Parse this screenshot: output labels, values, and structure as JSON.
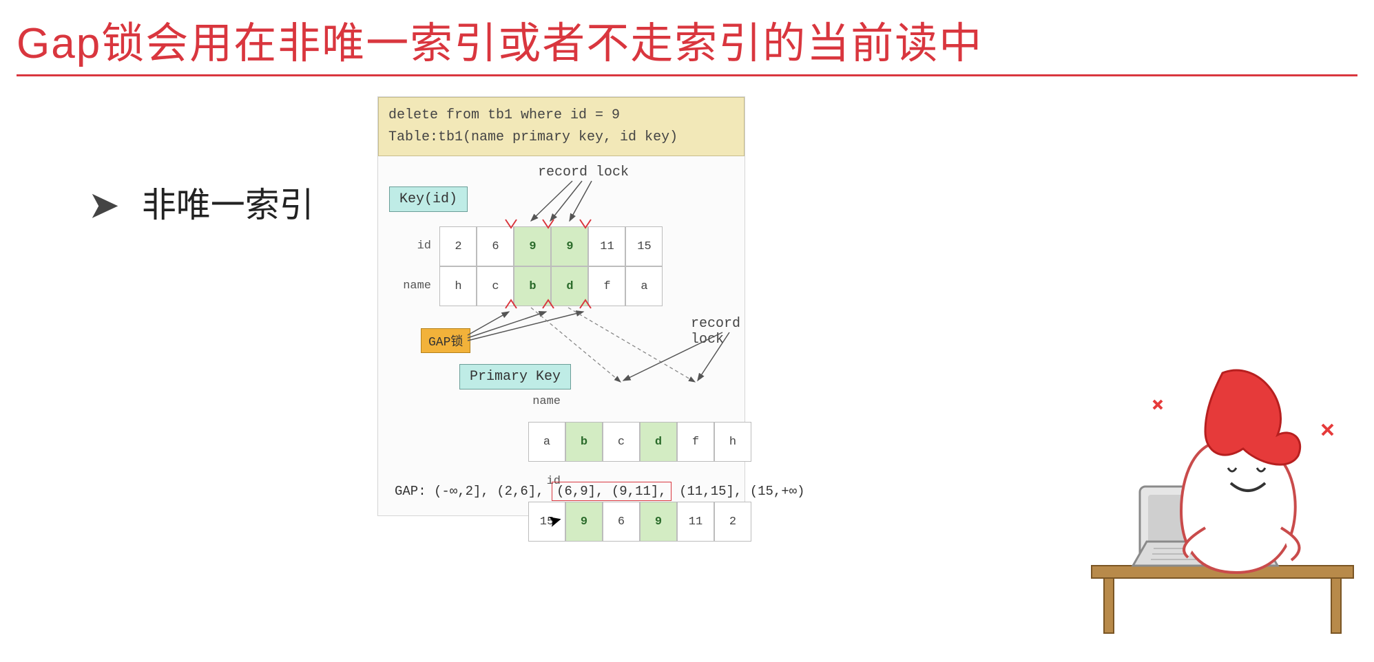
{
  "title": "Gap锁会用在非唯一索引或者不走索引的当前读中",
  "bullet": {
    "arrow": "➤",
    "text": "非唯一索引"
  },
  "sql": {
    "line1": "delete from tb1 where id = 9",
    "line2": " Table:tb1(name primary key, id key)"
  },
  "labels": {
    "record_lock": "record lock",
    "key_id": "Key(id)",
    "gap_lock": "GAP锁",
    "primary_key": "Primary Key",
    "gap_prefix": "GAP:"
  },
  "index_table": {
    "row_labels": [
      "id",
      "name"
    ],
    "rows": [
      [
        {
          "v": "2",
          "hl": false
        },
        {
          "v": "6",
          "hl": false
        },
        {
          "v": "9",
          "hl": true
        },
        {
          "v": "9",
          "hl": true
        },
        {
          "v": "11",
          "hl": false
        },
        {
          "v": "15",
          "hl": false
        }
      ],
      [
        {
          "v": "h",
          "hl": false
        },
        {
          "v": "c",
          "hl": false
        },
        {
          "v": "b",
          "hl": true
        },
        {
          "v": "d",
          "hl": true
        },
        {
          "v": "f",
          "hl": false
        },
        {
          "v": "a",
          "hl": false
        }
      ]
    ]
  },
  "pk_table": {
    "row_labels": [
      "name",
      "id"
    ],
    "rows": [
      [
        {
          "v": "a",
          "hl": false
        },
        {
          "v": "b",
          "hl": true
        },
        {
          "v": "c",
          "hl": false
        },
        {
          "v": "d",
          "hl": true
        },
        {
          "v": "f",
          "hl": false
        },
        {
          "v": "h",
          "hl": false
        }
      ],
      [
        {
          "v": "15",
          "hl": false
        },
        {
          "v": "9",
          "hl": true
        },
        {
          "v": "6",
          "hl": false
        },
        {
          "v": "9",
          "hl": true
        },
        {
          "v": "11",
          "hl": false
        },
        {
          "v": "2",
          "hl": false
        }
      ]
    ]
  },
  "gap_intervals": {
    "pre": " (-∞,2], (2,6], ",
    "boxed": "(6,9], (9,11],",
    "post": " (11,15], (15,+∞)"
  }
}
